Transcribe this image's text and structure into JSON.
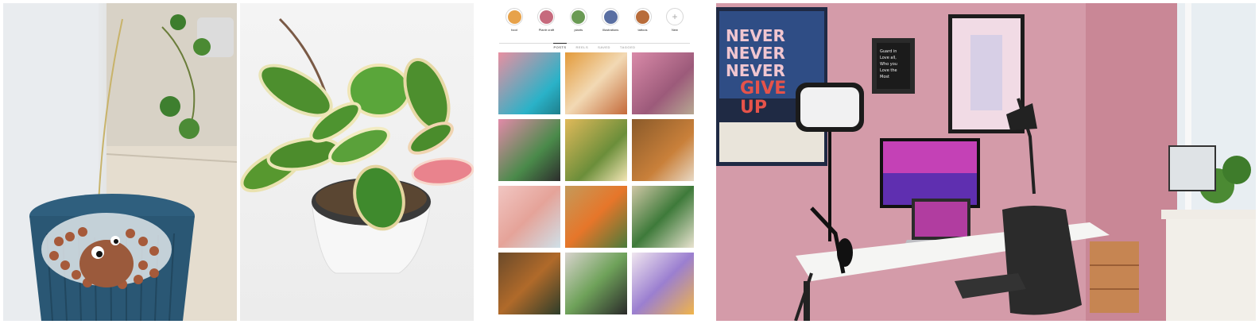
{
  "instagram": {
    "highlights": [
      {
        "label": "food",
        "color": "#e7a24a"
      },
      {
        "label": "Plantr craft",
        "color": "#c66a7d"
      },
      {
        "label": "plants",
        "color": "#6a9a54"
      },
      {
        "label": "Illustrations",
        "color": "#5a6fa2"
      },
      {
        "label": "tattoos",
        "color": "#b86c3a"
      },
      {
        "label": "New",
        "color": ""
      }
    ],
    "tabs": [
      {
        "label": "POSTS",
        "active": true
      },
      {
        "label": "REELS",
        "active": false
      },
      {
        "label": "SAVED",
        "active": false
      },
      {
        "label": "TAGGED",
        "active": false
      }
    ]
  },
  "desk": {
    "posters": [
      "NEVER",
      "NEVER",
      "NEVER",
      "GIVE",
      "UP"
    ],
    "sign_lines": [
      "Guard in",
      "Love all,",
      "Who you",
      "Love the",
      "Most"
    ]
  }
}
